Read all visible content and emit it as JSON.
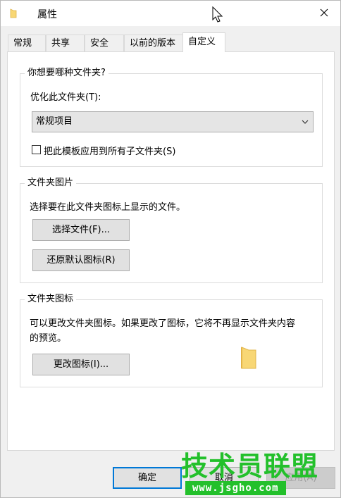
{
  "window": {
    "title": "属性"
  },
  "tabs": [
    {
      "label": "常规"
    },
    {
      "label": "共享"
    },
    {
      "label": "安全"
    },
    {
      "label": "以前的版本"
    },
    {
      "label": "自定义"
    }
  ],
  "folder_type_group": {
    "legend": "你想要哪种文件夹?",
    "optimize_label": "优化此文件夹(T):",
    "optimize_value": "常规项目",
    "apply_subfolders_label": "把此模板应用到所有子文件夹(S)",
    "apply_subfolders_checked": false
  },
  "folder_pictures_group": {
    "legend": "文件夹图片",
    "description": "选择要在此文件夹图标上显示的文件。",
    "choose_file_button": "选择文件(F)...",
    "restore_default_button": "还原默认图标(R)"
  },
  "folder_icons_group": {
    "legend": "文件夹图标",
    "description_line1": "可以更改文件夹图标。如果更改了图标，它将不再显示文件夹内容",
    "description_line2": "的预览。",
    "change_icon_button": "更改图标(I)..."
  },
  "footer": {
    "ok_button": "确定",
    "cancel_button": "取消",
    "apply_button": "应用(A)"
  },
  "watermark": {
    "title": "技术员联盟",
    "url": "www.jsgho.com"
  },
  "colors": {
    "accent": "#0078d7",
    "folder_yellow": "#f8d775",
    "watermark_green": "#23c02b"
  }
}
